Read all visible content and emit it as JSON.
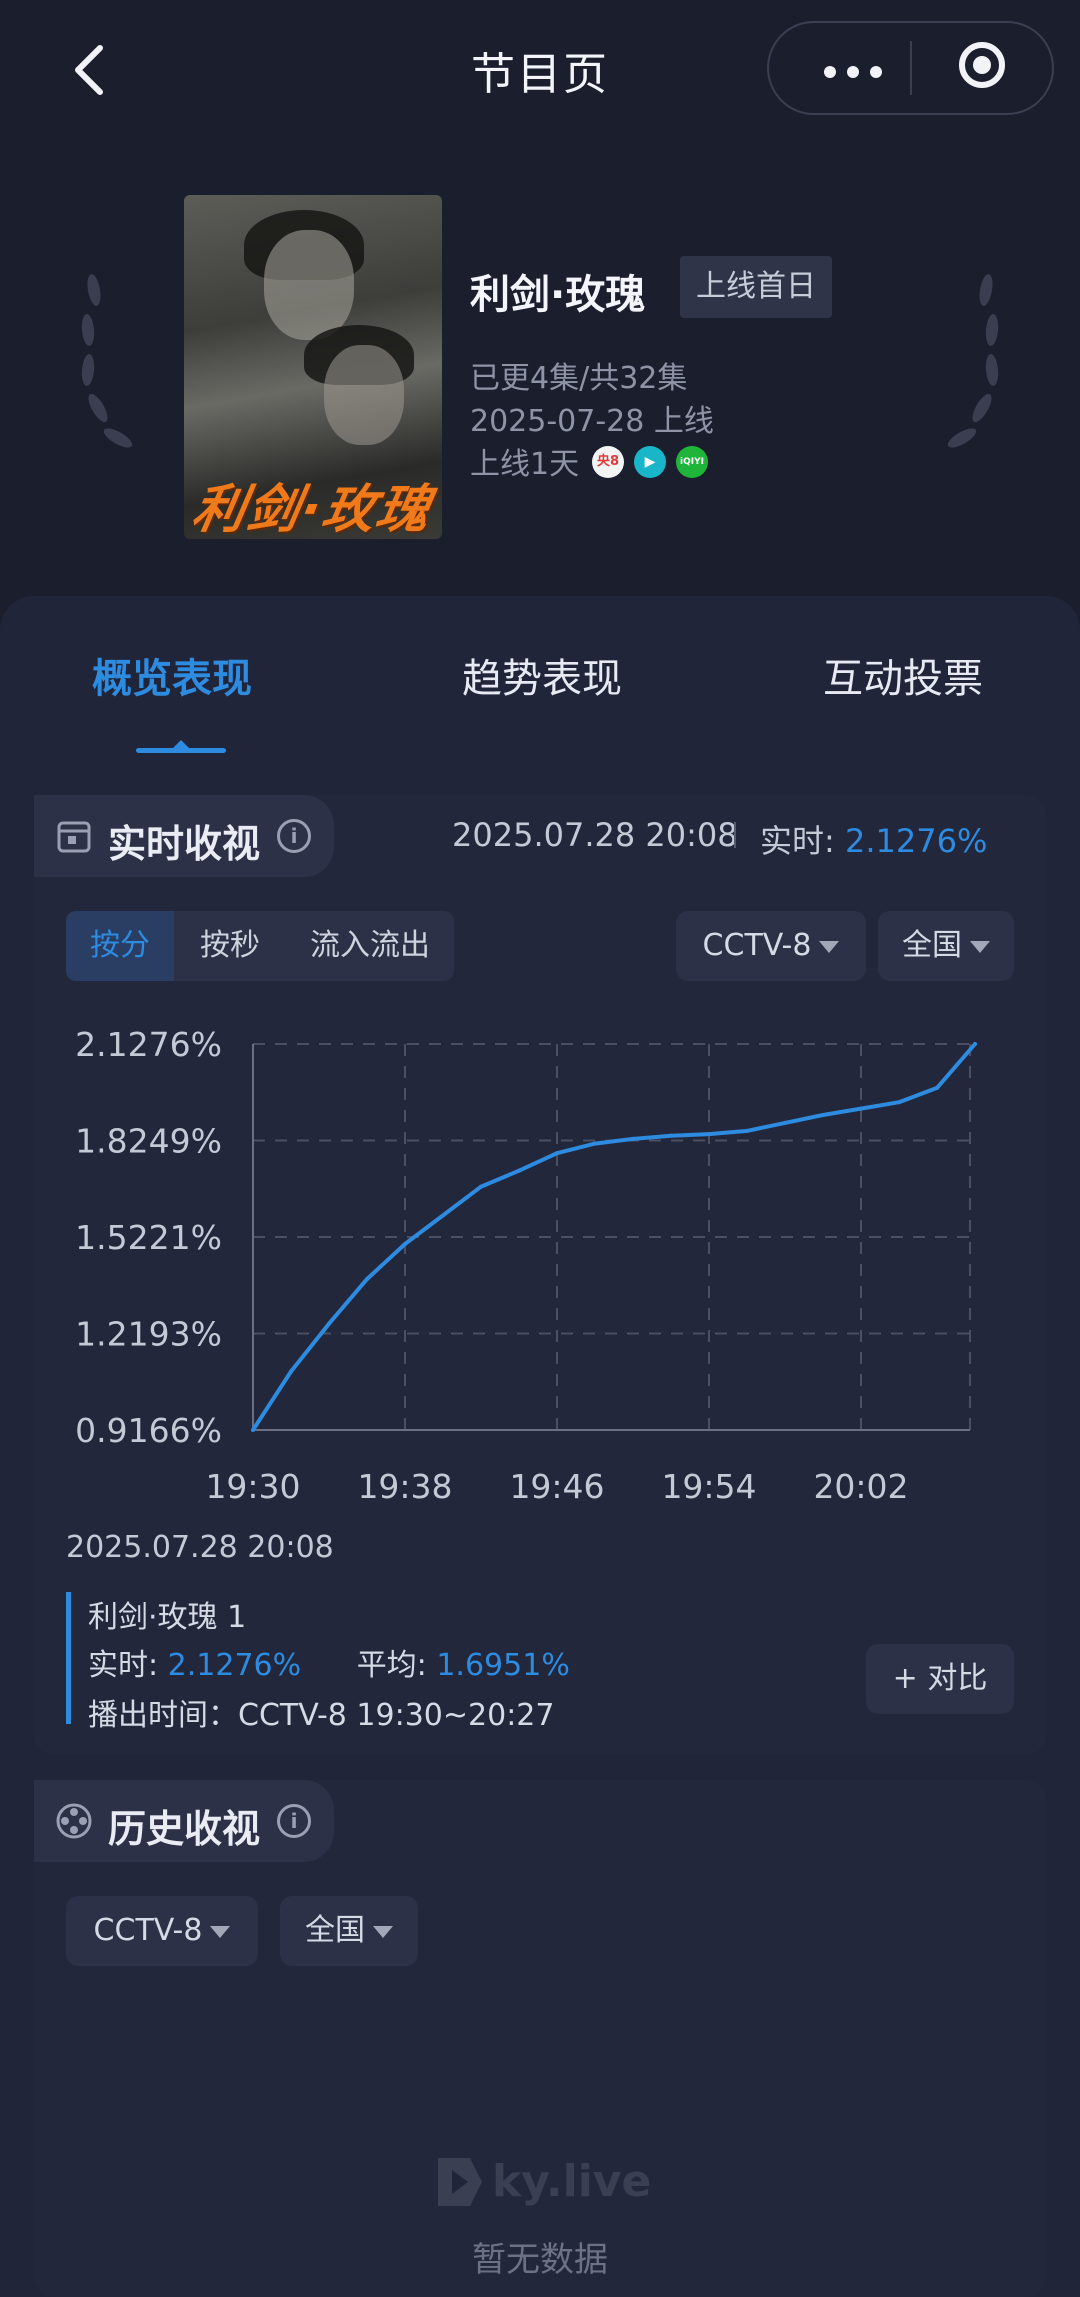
{
  "header": {
    "title": "节目页"
  },
  "show": {
    "title": "利剑·玫瑰",
    "badge": "上线首日",
    "episodes": "已更4集/共32集",
    "release": "2025-07-28 上线",
    "days": "上线1天",
    "poster_text": "利剑·玫瑰",
    "platforms": [
      {
        "label": "央8",
        "color": "#e23a3a"
      },
      {
        "label": "▶",
        "color": "#19b6c9"
      },
      {
        "label": "iQIYI",
        "color": "#1fb53b"
      }
    ]
  },
  "tabs": [
    {
      "label": "概览表现",
      "active": true
    },
    {
      "label": "趋势表现",
      "active": false
    },
    {
      "label": "互动投票",
      "active": false
    }
  ],
  "realtime": {
    "section_title": "实时收视",
    "timestamp": "2025.07.28 20:08",
    "rt_label": "实时:",
    "rt_value": "2.1276%",
    "segments": [
      "按分",
      "按秒",
      "流入流出"
    ],
    "channel": "CCTV-8",
    "region": "全国"
  },
  "chart_data": {
    "type": "line",
    "x": [
      "19:30",
      "19:32",
      "19:34",
      "19:36",
      "19:38",
      "19:40",
      "19:42",
      "19:44",
      "19:46",
      "19:48",
      "19:50",
      "19:52",
      "19:54",
      "19:56",
      "19:58",
      "20:00",
      "20:02",
      "20:04",
      "20:06",
      "20:08"
    ],
    "series": [
      {
        "values": [
          0.9166,
          1.1,
          1.25,
          1.39,
          1.5,
          1.59,
          1.68,
          1.73,
          1.785,
          1.815,
          1.83,
          1.84,
          1.845,
          1.855,
          1.88,
          1.905,
          1.925,
          1.945,
          1.99,
          2.1276
        ]
      }
    ],
    "x_ticks": [
      "19:30",
      "19:38",
      "19:46",
      "19:54",
      "20:02"
    ],
    "y_ticks": [
      "2.1276%",
      "1.8249%",
      "1.5221%",
      "1.2193%",
      "0.9166%"
    ],
    "ylim": [
      0.9166,
      2.1276
    ],
    "grid": true,
    "color": "#2d8be0"
  },
  "tooltip": {
    "date": "2025.07.28 20:08",
    "name": "利剑·玫瑰 1",
    "rt_label": "实时:",
    "rt_value": "2.1276%",
    "avg_label": "平均:",
    "avg_value": "1.6951%",
    "air": "播出时间：CCTV-8 19:30~20:27",
    "compare": "+ 对比"
  },
  "history": {
    "section_title": "历史收视",
    "channel": "CCTV-8",
    "region": "全国",
    "logo": "ky.live",
    "empty": "暂无数据"
  }
}
